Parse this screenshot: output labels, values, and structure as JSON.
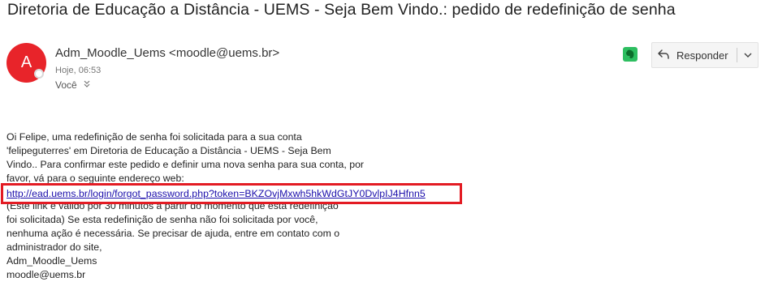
{
  "email": {
    "subject": "Diretoria de Educação a Distância - UEMS - Seja Bem Vindo.: pedido de redefinição de senha",
    "avatar_letter": "A",
    "sender": "Adm_Moodle_Uems <moodle@uems.br>",
    "time": "Hoje, 06:53",
    "recipient": "Você",
    "reply_label": "Responder",
    "body_lines_top": [
      "Oi Felipe, uma redefinição de senha foi solicitada para a sua conta",
      "'felipeguterres' em Diretoria de Educação a Distância - UEMS  - Seja Bem",
      "Vindo.. Para confirmar este pedido e definir uma nova senha para sua conta, por",
      "favor, vá para o seguinte endereço web:"
    ],
    "link": "http://ead.uems.br/login/forgot_password.php?token=BKZOvjMxwh5hkWdGtJY0DvlpIJ4Hfnn5",
    "body_lines_bottom": [
      "(Este link é válido por 30 minutos a partir do momento que esta redefinição",
      "foi solicitada) Se esta redefinição de senha não foi solicitada por você,",
      "nenhuma ação é necessária. Se precisar de ajuda, entre em contato com o",
      "administrador do site,",
      "Adm_Moodle_Uems",
      "moodle@uems.br"
    ]
  },
  "colors": {
    "avatar": "#e8242a",
    "highlight_border": "#e31b23",
    "link": "#1a0dab",
    "evernote": "#2dbe60"
  }
}
